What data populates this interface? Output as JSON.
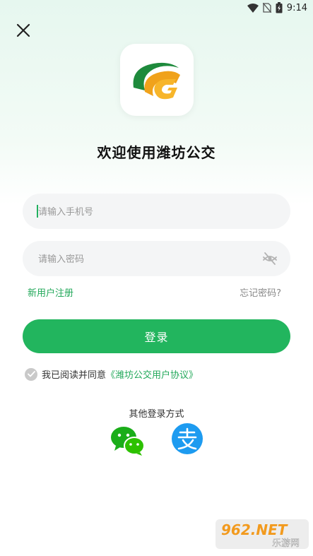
{
  "status_bar": {
    "time": "9:14",
    "battery_icon": "battery-charging-icon",
    "wifi_icon": "wifi-icon",
    "signal_icon": "no-sim-icon"
  },
  "header": {
    "close_icon": "close-icon"
  },
  "app": {
    "logo_icon": "app-logo-icon",
    "title": "欢迎使用潍坊公交"
  },
  "form": {
    "phone_placeholder": "请输入手机号",
    "password_placeholder": "请输入密码",
    "password_toggle_icon": "eye-off-icon",
    "register_label": "新用户注册",
    "forgot_label": "忘记密码?",
    "login_label": "登录"
  },
  "agreement": {
    "text": "我已阅读并同意",
    "link": "《潍坊公交用户协议》"
  },
  "other_login": {
    "title": "其他登录方式",
    "methods": [
      {
        "icon": "wechat-icon"
      },
      {
        "icon": "alipay-icon"
      }
    ]
  },
  "watermark": {
    "brand": "962.NET",
    "sub": "乐游网"
  },
  "colors": {
    "accent": "#22b55e",
    "link": "#22a85a",
    "alipay": "#1d9bf0"
  }
}
